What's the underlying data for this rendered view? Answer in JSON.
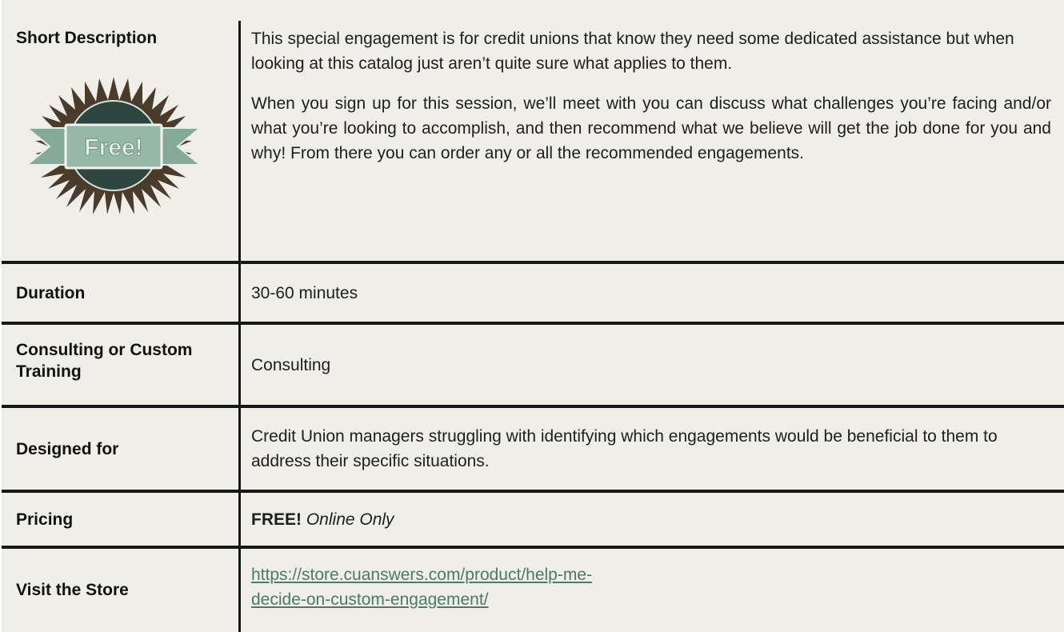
{
  "rows": [
    {
      "label": "Short Description",
      "paragraphs": [
        "This special engagement is for credit unions that know they need some dedicated assistance but when looking at this catalog just aren’t quite sure what applies to them.",
        "When you sign up for this session, we’ll meet with you can discuss what challenges you’re facing and/or what you’re looking to accomplish, and then recommend what we believe will get the job done for you and why! From there you can order any or all the recommended engagements."
      ],
      "badge_text": "Free!",
      "badge_icon": "free-starburst-ribbon-icon"
    },
    {
      "label": "Duration",
      "value": "30-60 minutes"
    },
    {
      "label": "Consulting or Custom Training",
      "value": "Consulting"
    },
    {
      "label": "Designed for",
      "value": "Credit Union managers struggling with identifying which engagements would be beneficial to them to address their specific situations."
    },
    {
      "label": "Pricing",
      "value_bold": "FREE!",
      "value_italic": "Online Only"
    },
    {
      "label": "Visit the Store",
      "link_text": "https://store.cuanswers.com/product/help-me-decide-on-custom-engagement/"
    }
  ],
  "colors": {
    "background": "#f0eee9",
    "rules": "#161616",
    "link": "#4a7a6c",
    "badge_star": "#4a3b2a",
    "badge_circle": "#2f4540",
    "badge_ribbon": "#86a998"
  }
}
